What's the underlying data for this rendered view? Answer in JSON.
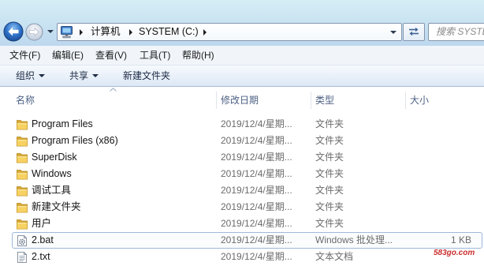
{
  "window": {
    "frame_color": "#c9e3f2"
  },
  "nav": {
    "back_icon": "back-arrow-icon",
    "forward_icon": "forward-arrow-icon",
    "history_icon": "chevron-down-icon"
  },
  "address": {
    "location_icon": "computer-icon",
    "separator_icon": "chevron-right-icon",
    "segments": [
      "计算机",
      "SYSTEM (C:)"
    ],
    "dropdown_icon": "chevron-down-icon"
  },
  "refresh": {
    "icon": "refresh-icon"
  },
  "search": {
    "placeholder": "搜索 SYSTE"
  },
  "menu": {
    "items": [
      "文件(F)",
      "编辑(E)",
      "查看(V)",
      "工具(T)",
      "帮助(H)"
    ]
  },
  "toolbar": {
    "organize": "组织",
    "share": "共享",
    "new_folder": "新建文件夹"
  },
  "columns": {
    "name": "名称",
    "date": "修改日期",
    "type": "类型",
    "size": "大小",
    "sort_icon": "sort-up-icon"
  },
  "files": [
    {
      "name": "Program Files",
      "date": "2019/12/4/星期...",
      "type": "文件夹",
      "icon": "folder-icon"
    },
    {
      "name": "Program Files (x86)",
      "date": "2019/12/4/星期...",
      "type": "文件夹",
      "icon": "folder-icon"
    },
    {
      "name": "SuperDisk",
      "date": "2019/12/4/星期...",
      "type": "文件夹",
      "icon": "folder-icon"
    },
    {
      "name": "Windows",
      "date": "2019/12/4/星期...",
      "type": "文件夹",
      "icon": "folder-icon"
    },
    {
      "name": "调试工具",
      "date": "2019/12/4/星期...",
      "type": "文件夹",
      "icon": "folder-icon"
    },
    {
      "name": "新建文件夹",
      "date": "2019/12/4/星期...",
      "type": "文件夹",
      "icon": "folder-icon"
    },
    {
      "name": "用户",
      "date": "2019/12/4/星期...",
      "type": "文件夹",
      "icon": "folder-icon"
    },
    {
      "name": "2.bat",
      "date": "2019/12/4/星期...",
      "type": "Windows 批处理...",
      "size": "1 KB",
      "icon": "batch-file-icon",
      "selected": true
    },
    {
      "name": "2.txt",
      "date": "2019/12/4/星期...",
      "type": "文本文档",
      "icon": "text-file-icon"
    }
  ],
  "watermark": "583go.com",
  "colors": {
    "accent": "#2f72c9",
    "selection_border": "#9db9da",
    "header_text": "#4d6185",
    "folder": "#f6cf5c",
    "watermark": "#cc2e2e"
  }
}
